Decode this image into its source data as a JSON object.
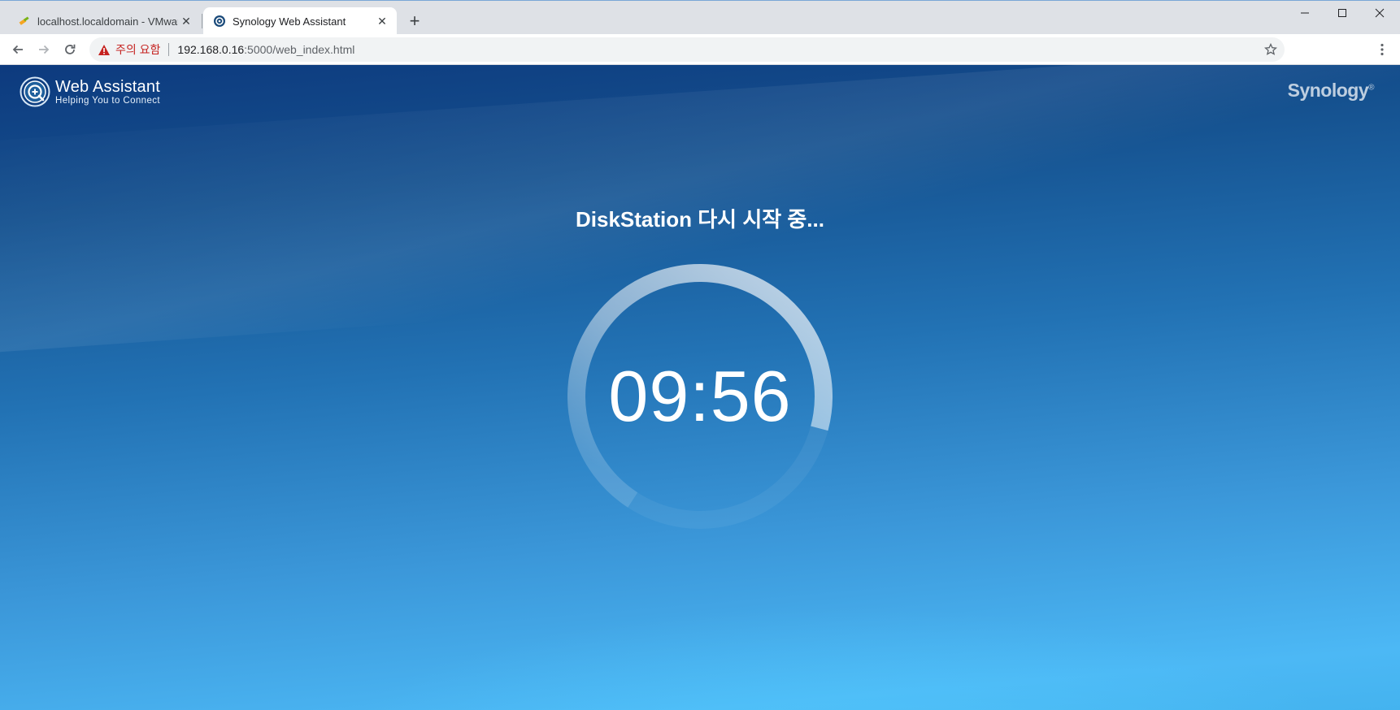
{
  "browser": {
    "tabs": [
      {
        "title": "localhost.localdomain - VMware",
        "icon": "vmware-favicon-icon",
        "active": false
      },
      {
        "title": "Synology Web Assistant",
        "icon": "synology-favicon-icon",
        "active": true
      }
    ],
    "address": {
      "warning": "주의 요함",
      "url_host": "192.168.0.16",
      "url_path": ":5000/web_index.html"
    }
  },
  "page": {
    "brand_title": "Web Assistant",
    "brand_subtitle": "Helping You to Connect",
    "vendor": "Synology",
    "vendor_mark": "®",
    "status": "DiskStation 다시 시작 중...",
    "countdown": "09:56",
    "countdown_progress_remaining": 0.7
  },
  "colors": {
    "page_top": "#0d3a7e",
    "page_bottom": "#4cb8f5",
    "warning_red": "#c5221f"
  }
}
